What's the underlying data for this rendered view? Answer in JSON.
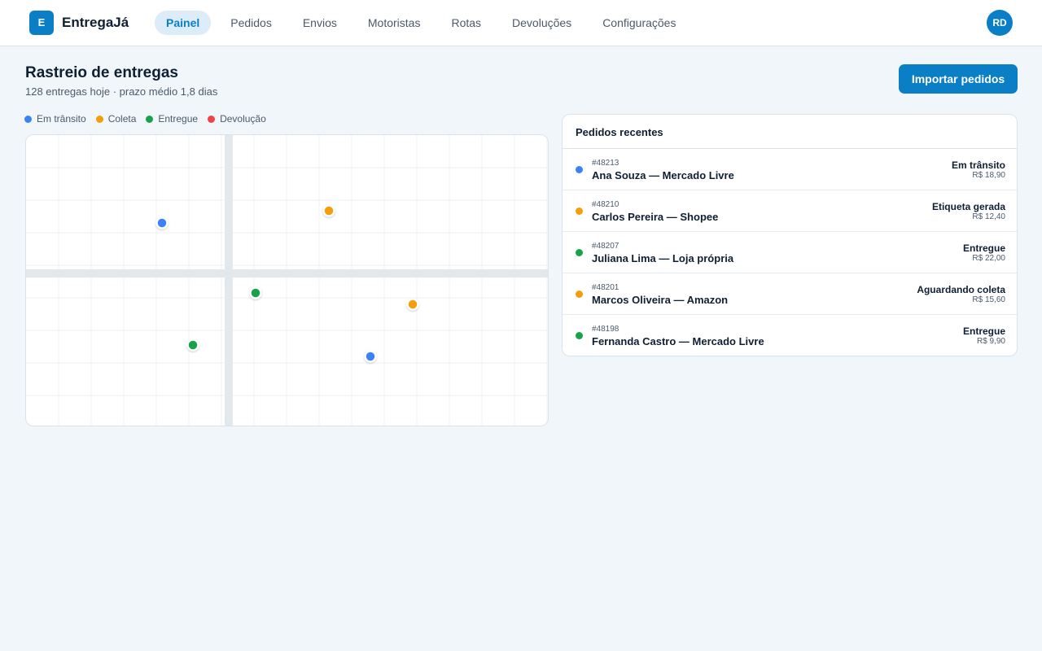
{
  "app": {
    "logo_letter": "E",
    "brand": "EntregaJá",
    "user_initials": "RD"
  },
  "nav": [
    {
      "label": "Painel",
      "active": true
    },
    {
      "label": "Pedidos",
      "active": false
    },
    {
      "label": "Envios",
      "active": false
    },
    {
      "label": "Motoristas",
      "active": false
    },
    {
      "label": "Rotas",
      "active": false
    },
    {
      "label": "Devoluções",
      "active": false
    },
    {
      "label": "Configurações",
      "active": false
    }
  ],
  "header": {
    "title": "Rastreio de entregas",
    "subtitle": "128 entregas hoje · prazo médio 1,8 dias",
    "import_label": "Importar pedidos"
  },
  "legend": [
    {
      "label": "Em trânsito",
      "status": "transit",
      "color": "#3b82f6"
    },
    {
      "label": "Coleta",
      "status": "pickup",
      "color": "#f59e0b"
    },
    {
      "label": "Entregue",
      "status": "delivered",
      "color": "#16a34a"
    },
    {
      "label": "Devolução",
      "status": "return",
      "color": "#ef4444"
    }
  ],
  "map": {
    "markers": [
      {
        "status": "transit"
      },
      {
        "status": "pickup"
      },
      {
        "status": "delivered"
      },
      {
        "status": "pickup"
      },
      {
        "status": "delivered"
      },
      {
        "status": "transit"
      }
    ]
  },
  "orders": {
    "title": "Pedidos recentes",
    "items": [
      {
        "id": "#48213",
        "name": "Ana Souza — Mercado Livre",
        "status": "Em trânsito",
        "price": "R$ 18,90",
        "color": "#3b82f6"
      },
      {
        "id": "#48210",
        "name": "Carlos Pereira — Shopee",
        "status": "Etiqueta gerada",
        "price": "R$ 12,40",
        "color": "#f59e0b"
      },
      {
        "id": "#48207",
        "name": "Juliana Lima — Loja própria",
        "status": "Entregue",
        "price": "R$ 22,00",
        "color": "#16a34a"
      },
      {
        "id": "#48201",
        "name": "Marcos Oliveira — Amazon",
        "status": "Aguardando coleta",
        "price": "R$ 15,60",
        "color": "#f59e0b"
      },
      {
        "id": "#48198",
        "name": "Fernanda Castro — Mercado Livre",
        "status": "Entregue",
        "price": "R$ 9,90",
        "color": "#16a34a"
      }
    ]
  }
}
